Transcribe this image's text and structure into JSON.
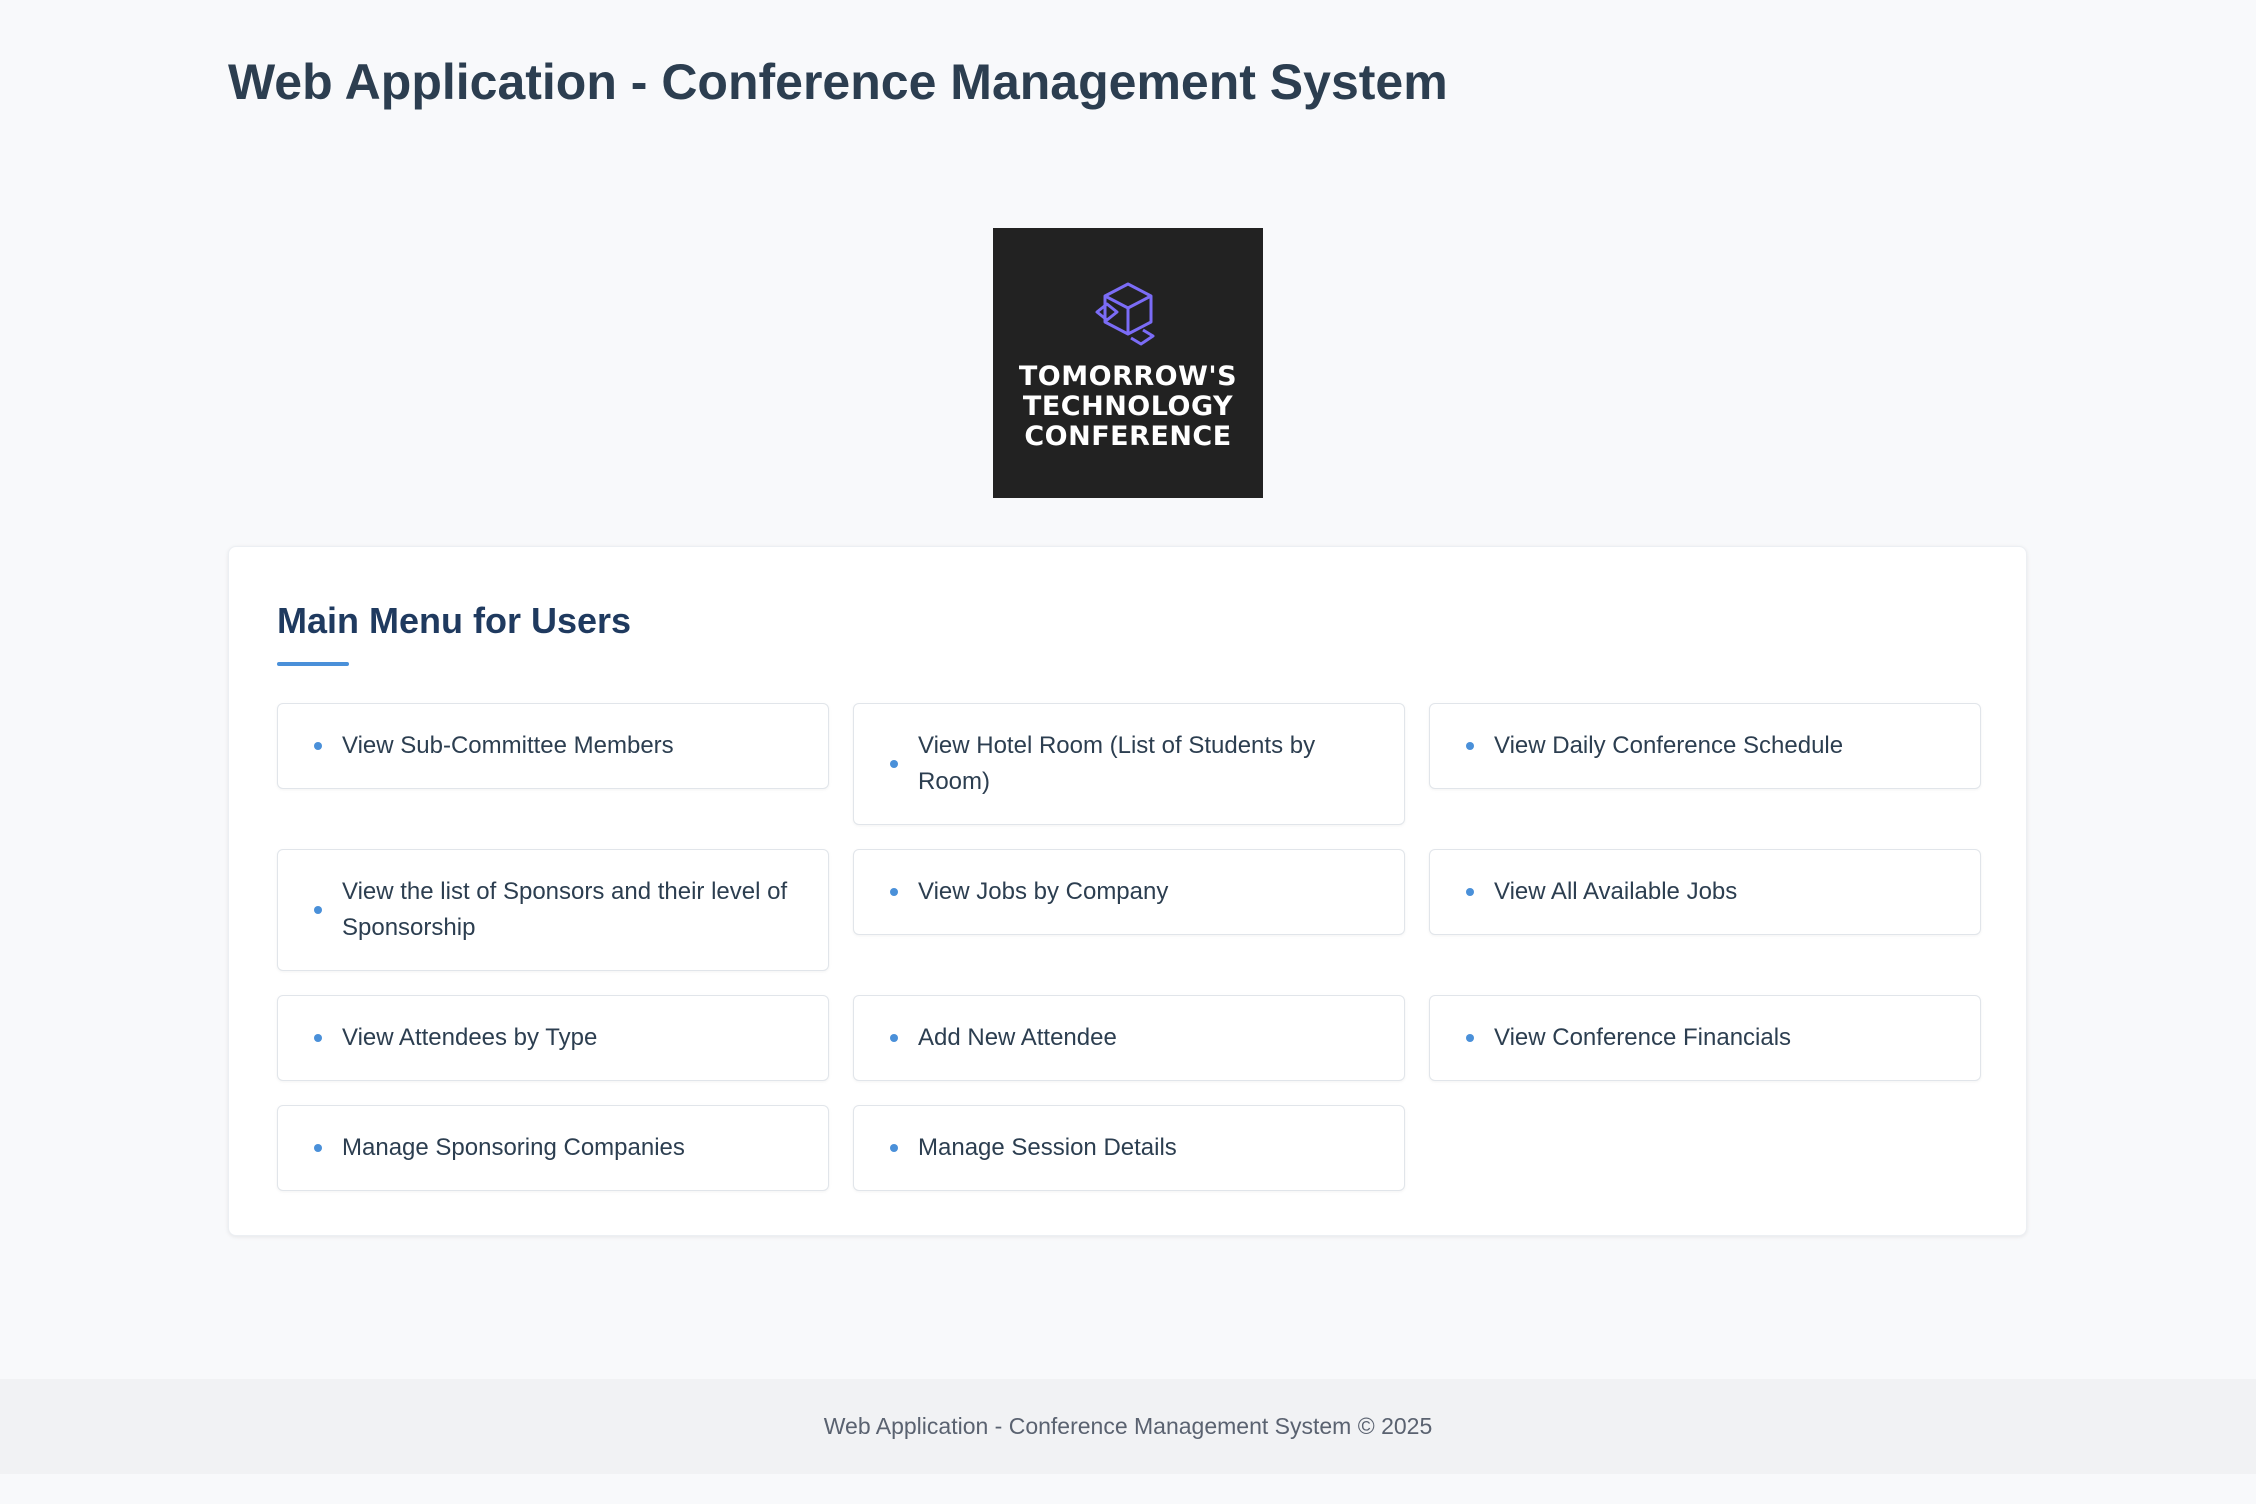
{
  "page": {
    "title": "Web Application - Conference Management System"
  },
  "logo": {
    "icon": "cube-outline-icon",
    "icon_color": "#7b6cf6",
    "lines": [
      "TOMORROW'S",
      "TECHNOLOGY",
      "CONFERENCE"
    ]
  },
  "menu": {
    "heading": "Main Menu for Users",
    "accent_color": "#4a90d9",
    "items": [
      {
        "label": "View Sub-Committee Members"
      },
      {
        "label": "View Hotel Room (List of Students by Room)"
      },
      {
        "label": "View Daily Conference Schedule"
      },
      {
        "label": "View the list of Sponsors and their level of Sponsorship"
      },
      {
        "label": "View Jobs by Company"
      },
      {
        "label": "View All Available Jobs"
      },
      {
        "label": "View Attendees by Type"
      },
      {
        "label": "Add New Attendee"
      },
      {
        "label": "View Conference Financials"
      },
      {
        "label": "Manage Sponsoring Companies"
      },
      {
        "label": "Manage Session Details"
      }
    ]
  },
  "footer": {
    "text": "Web Application - Conference Management System © 2025"
  }
}
